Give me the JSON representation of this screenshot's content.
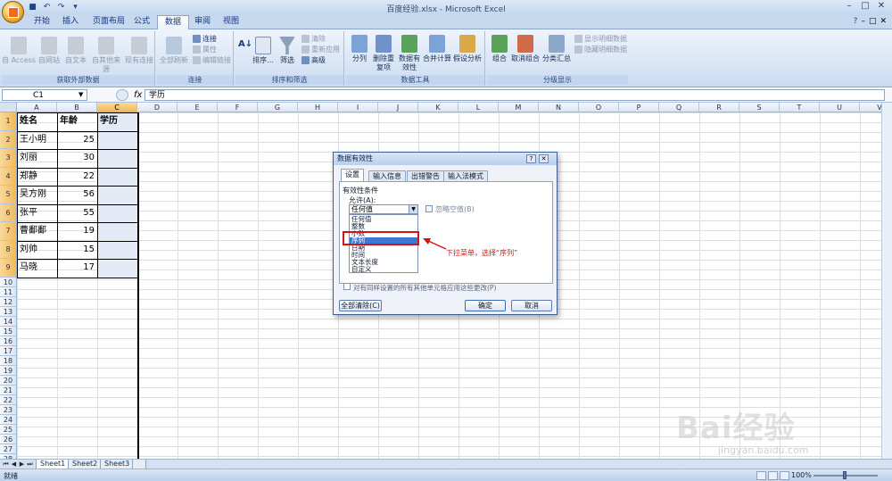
{
  "window": {
    "title": "百度经验.xlsx - Microsoft Excel",
    "controls": [
      "–",
      "□",
      "✕"
    ],
    "doc_controls": [
      "–",
      "□",
      "✕"
    ]
  },
  "ribbon_tabs": [
    "开始",
    "插入",
    "页面布局",
    "公式",
    "数据",
    "审阅",
    "视图"
  ],
  "ribbon_active_tab": "数据",
  "ribbon": {
    "get_external": {
      "label": "获取外部数据",
      "buttons": [
        "自 Access",
        "自网站",
        "自文本",
        "自其他来源",
        "现有连接"
      ]
    },
    "connections": {
      "label": "连接",
      "refresh": "全部刷新",
      "items": [
        "连接",
        "属性",
        "编辑链接"
      ]
    },
    "sort_filter": {
      "label": "排序和筛选",
      "sort": "排序...",
      "filter": "筛选",
      "items": [
        "清除",
        "重新应用",
        "高级"
      ]
    },
    "data_tools": {
      "label": "数据工具",
      "buttons": [
        "分列",
        "删除重复项",
        "数据有效性",
        "合并计算",
        "假设分析"
      ]
    },
    "outline": {
      "label": "分级显示",
      "buttons": [
        "组合",
        "取消组合",
        "分类汇总"
      ],
      "items": [
        "显示明细数据",
        "隐藏明细数据"
      ]
    }
  },
  "formula_bar": {
    "name_box": "C1",
    "fx": "fx",
    "formula": "学历"
  },
  "columns": [
    "A",
    "B",
    "C",
    "D",
    "E",
    "F",
    "G",
    "H",
    "I",
    "J",
    "K",
    "L",
    "M",
    "N",
    "O",
    "P",
    "Q",
    "R",
    "S",
    "T",
    "U",
    "V"
  ],
  "rows": [
    "1",
    "2",
    "3",
    "4",
    "5",
    "6",
    "7",
    "8",
    "9",
    "10",
    "11",
    "12",
    "13",
    "14",
    "15",
    "16",
    "17",
    "18",
    "19",
    "20",
    "21",
    "22",
    "23",
    "24",
    "25",
    "26",
    "27",
    "28"
  ],
  "table": {
    "headers": [
      "姓名",
      "年龄",
      "学历"
    ],
    "rows": [
      [
        "王小明",
        "25"
      ],
      [
        "刘丽",
        "30"
      ],
      [
        "郑静",
        "22"
      ],
      [
        "吴方刚",
        "56"
      ],
      [
        "张平",
        "55"
      ],
      [
        "曹鄱鄱",
        "19"
      ],
      [
        "刘帅",
        "15"
      ],
      [
        "马晓",
        "17"
      ]
    ]
  },
  "dialog": {
    "title": "数据有效性",
    "tabs": [
      "设置",
      "输入信息",
      "出错警告",
      "输入法模式"
    ],
    "active_tab": "设置",
    "criteria_label": "有效性条件",
    "allow_label": "允许(A):",
    "allow_value": "任何值",
    "ignore_blank": "忽略空值(B)",
    "options": [
      "任何值",
      "整数",
      "小数",
      "序列",
      "日期",
      "时间",
      "文本长度",
      "自定义"
    ],
    "highlighted_option": "序列",
    "apply_all": "对有同样设置的所有其他单元格应用这些更改(P)",
    "clear_all": "全部清除(C)",
    "ok": "确定",
    "cancel": "取消"
  },
  "annotation": {
    "text": "下拉菜单，选择“序列”",
    "color": "#d11414"
  },
  "sheets": [
    "Sheet1",
    "Sheet2",
    "Sheet3"
  ],
  "active_sheet": "Sheet1",
  "status": {
    "mode": "就绪",
    "zoom": "100%"
  },
  "watermark": {
    "brand": "Bai经验",
    "url": "jingyan.baidu.com"
  }
}
